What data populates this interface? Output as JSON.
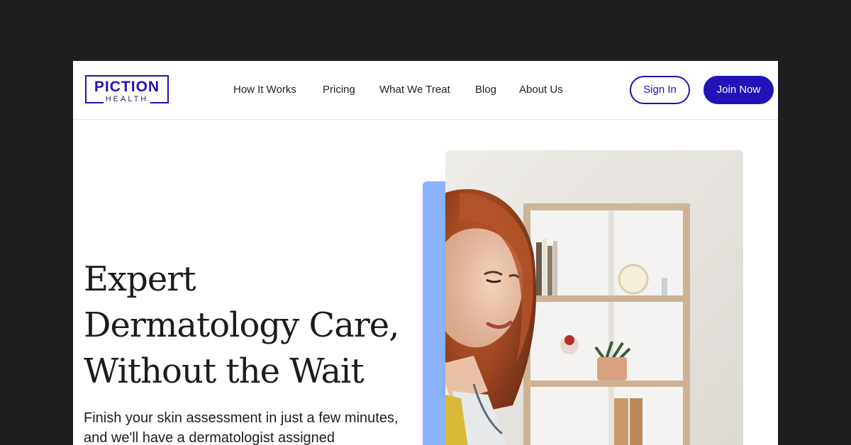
{
  "brand": {
    "name_top": "PICTION",
    "name_bottom": "HEALTH",
    "color": "#2212b8"
  },
  "nav": {
    "items": [
      {
        "label": "How It Works"
      },
      {
        "label": "Pricing"
      },
      {
        "label": "What We Treat"
      },
      {
        "label": "Blog"
      },
      {
        "label": "About Us"
      }
    ]
  },
  "header_actions": {
    "sign_in": "Sign In",
    "join_now": "Join Now"
  },
  "hero": {
    "headline_lines": [
      "Expert",
      "Dermatology Care,",
      "Without the Wait"
    ],
    "subtext_lines": [
      "Finish your skin assessment in just a few minutes,",
      "and we'll have a dermatologist assigned"
    ],
    "accent_color": "#8ab2ff",
    "image": "dermatologist-smiling-at-desk-photo"
  }
}
